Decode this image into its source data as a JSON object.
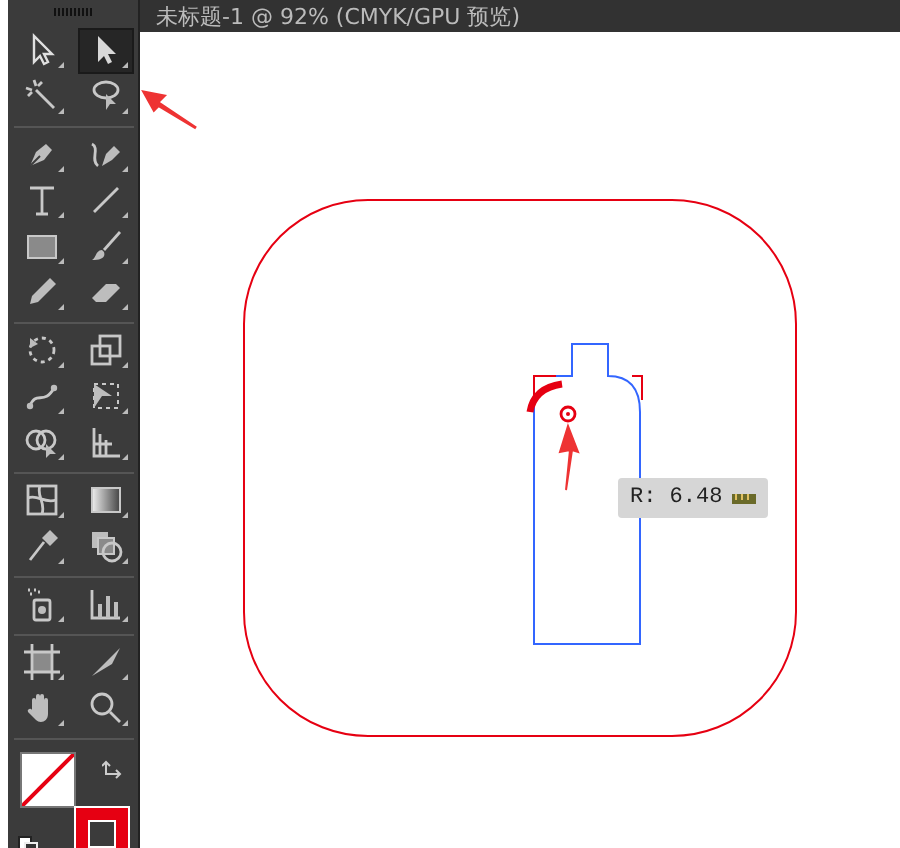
{
  "document_tab": {
    "title": "未标题-1 @ 92% (CMYK/GPU 预览)"
  },
  "tool_groups": [
    [
      {
        "kind": "selection",
        "selected": false
      },
      {
        "kind": "direct-selection",
        "selected": true
      },
      {
        "kind": "magic-wand",
        "selected": false
      },
      {
        "kind": "lasso",
        "selected": false
      }
    ],
    [
      {
        "kind": "pen",
        "selected": false
      },
      {
        "kind": "curvature",
        "selected": false
      },
      {
        "kind": "type",
        "selected": false
      },
      {
        "kind": "line",
        "selected": false
      },
      {
        "kind": "rectangle",
        "selected": false
      },
      {
        "kind": "brush",
        "selected": false
      },
      {
        "kind": "pencil",
        "selected": false
      },
      {
        "kind": "eraser",
        "selected": false
      }
    ],
    [
      {
        "kind": "rotate",
        "selected": false
      },
      {
        "kind": "scale",
        "selected": false
      },
      {
        "kind": "warp",
        "selected": false
      },
      {
        "kind": "free-transform",
        "selected": false
      },
      {
        "kind": "shape-builder",
        "selected": false
      },
      {
        "kind": "perspective",
        "selected": false
      }
    ],
    [
      {
        "kind": "mesh",
        "selected": false
      },
      {
        "kind": "gradient",
        "selected": false
      },
      {
        "kind": "eyedropper",
        "selected": false
      },
      {
        "kind": "blend",
        "selected": false
      }
    ],
    [
      {
        "kind": "sprayer",
        "selected": false
      },
      {
        "kind": "graph",
        "selected": false
      }
    ],
    [
      {
        "kind": "artboard",
        "selected": false
      },
      {
        "kind": "slice",
        "selected": false
      },
      {
        "kind": "hand",
        "selected": false
      },
      {
        "kind": "zoom",
        "selected": false
      }
    ]
  ],
  "stroke_swatch": {
    "color": "#e60012"
  },
  "measure_tooltip": {
    "text": "R: 6.48"
  }
}
